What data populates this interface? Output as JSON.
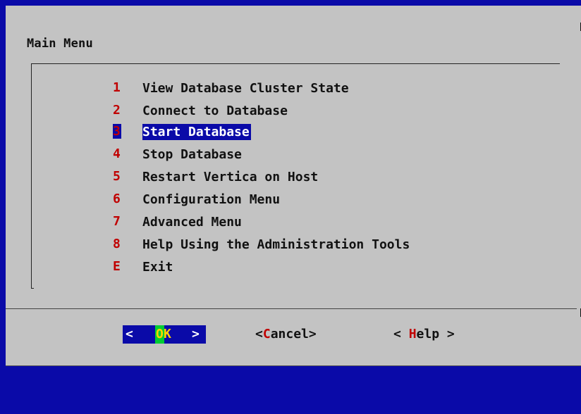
{
  "dialog": {
    "title": "Main Menu"
  },
  "menu": {
    "items": [
      {
        "key": "1",
        "label": "View Database Cluster State"
      },
      {
        "key": "2",
        "label": "Connect to Database"
      },
      {
        "key": "3",
        "label": "Start Database",
        "selected": true
      },
      {
        "key": "4",
        "label": "Stop Database"
      },
      {
        "key": "5",
        "label": "Restart Vertica on Host"
      },
      {
        "key": "6",
        "label": "Configuration Menu"
      },
      {
        "key": "7",
        "label": "Advanced Menu"
      },
      {
        "key": "8",
        "label": "Help Using the Administration Tools"
      },
      {
        "key": "E",
        "label": "Exit"
      }
    ]
  },
  "buttons": {
    "ok": {
      "left": "<",
      "hotkey": "O",
      "rest": "K",
      "right": ">"
    },
    "cancel": {
      "open": "<",
      "hotkey": "C",
      "rest": "ancel",
      "close": ">"
    },
    "help": {
      "open": "< ",
      "hotkey": "H",
      "rest": "elp",
      "close": " >"
    }
  },
  "colors": {
    "background": "#0a0aa8",
    "dialog": "#c3c3c3",
    "hotkey": "#c00000",
    "selection": "#0a0aa8",
    "ok_hotkey_bg": "#00cc33",
    "ok_text": "#ffd400"
  }
}
